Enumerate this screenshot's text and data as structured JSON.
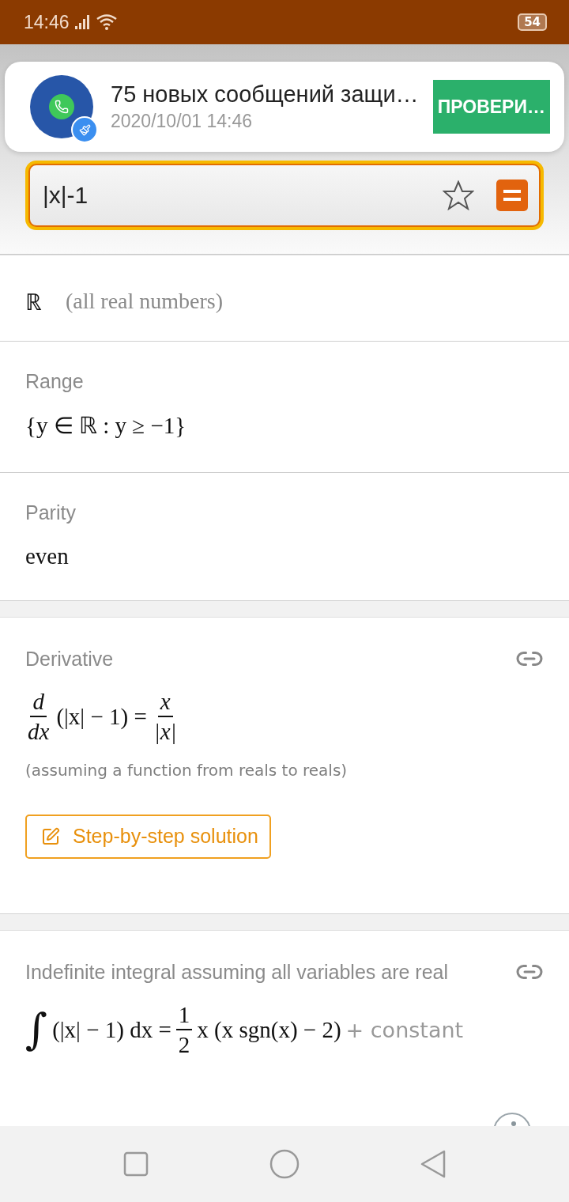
{
  "status_bar": {
    "time": "14:46",
    "battery": "54"
  },
  "notification": {
    "title": "75 новых сообщений защи…",
    "time": "2020/10/01 14:46",
    "action": "ПРОВЕРИ…"
  },
  "search": {
    "value": "|x|-1",
    "starred": false
  },
  "domain": {
    "value": "ℝ",
    "note": "(all real numbers)"
  },
  "range": {
    "label": "Range",
    "value": "{y ∈ ℝ : y ≥ −1}"
  },
  "parity": {
    "label": "Parity",
    "value": "even"
  },
  "derivative": {
    "label": "Derivative",
    "lhs_numerator": "d",
    "lhs_denominator": "dx",
    "lhs": "(|x| − 1) =",
    "rhs_numerator": "x",
    "rhs_denominator": "|x|",
    "note": "(assuming a function from reals to reals)",
    "button": "Step-by-step solution"
  },
  "integral": {
    "label": "Indefinite integral assuming all variables are real",
    "integral_sign": "∫",
    "lhs": "(|x| − 1) dx =",
    "coef_numerator": "1",
    "coef_denominator": "2",
    "rhs": "x (x sgn(x) − 2)",
    "constant": "+ constant"
  }
}
